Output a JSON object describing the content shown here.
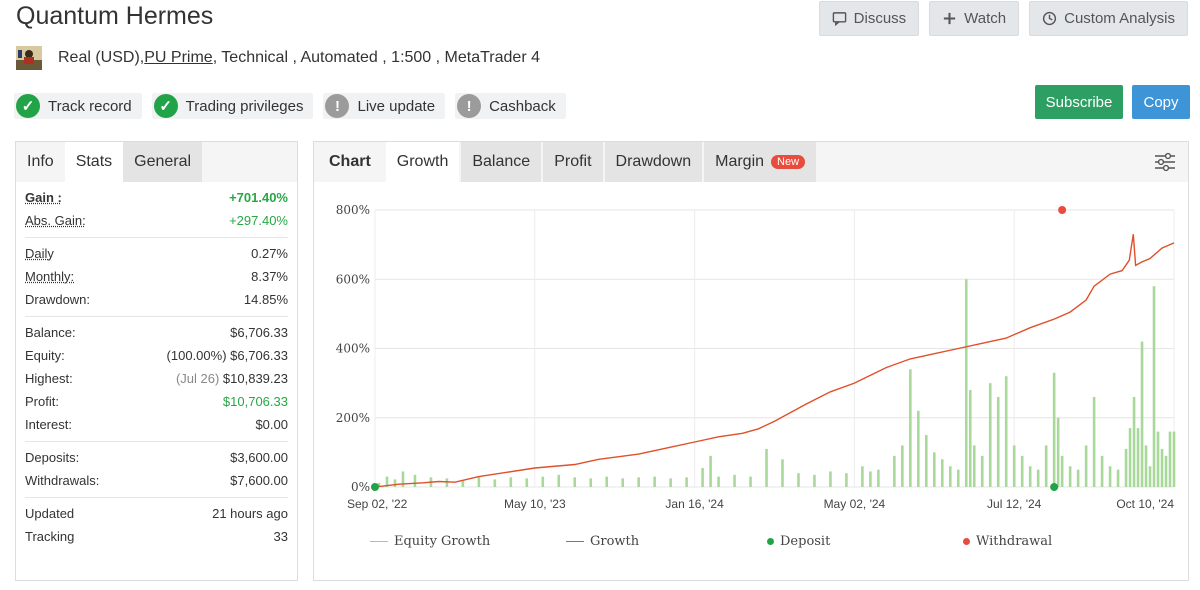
{
  "header": {
    "title": "Quantum Hermes",
    "discuss_label": "Discuss",
    "watch_label": "Watch",
    "custom_analysis_label": "Custom Analysis"
  },
  "subline": {
    "prefix": "Real (USD), ",
    "broker": "PU Prime",
    "suffix": " , Technical , Automated , 1:500 , MetaTrader 4"
  },
  "badges": [
    {
      "label": "Track record",
      "status": "ok"
    },
    {
      "label": "Trading privileges",
      "status": "ok"
    },
    {
      "label": "Live update",
      "status": "warn"
    },
    {
      "label": "Cashback",
      "status": "warn"
    }
  ],
  "actions": {
    "subscribe_label": "Subscribe",
    "copy_label": "Copy"
  },
  "left_tabs": [
    "Info",
    "Stats",
    "General"
  ],
  "stats": {
    "gain_label": "Gain :",
    "gain_value": "+701.40%",
    "abs_gain_label": "Abs. Gain:",
    "abs_gain_value": "+297.40%",
    "daily_label": "Daily",
    "daily_value": "0.27%",
    "monthly_label": "Monthly:",
    "monthly_value": "8.37%",
    "drawdown_label": "Drawdown:",
    "drawdown_value": "14.85%",
    "balance_label": "Balance:",
    "balance_value": "$6,706.33",
    "equity_label": "Equity:",
    "equity_pct": "(100.00%)",
    "equity_value": "$6,706.33",
    "highest_label": "Highest:",
    "highest_date": "(Jul 26)",
    "highest_value": "$10,839.23",
    "profit_label": "Profit:",
    "profit_value": "$10,706.33",
    "interest_label": "Interest:",
    "interest_value": "$0.00",
    "deposits_label": "Deposits:",
    "deposits_value": "$3,600.00",
    "withdrawals_label": "Withdrawals:",
    "withdrawals_value": "$7,600.00",
    "updated_label": "Updated",
    "updated_value": "21 hours ago",
    "tracking_label": "Tracking",
    "tracking_value": "33"
  },
  "right_tabs": {
    "chart": "Chart",
    "growth": "Growth",
    "balance": "Balance",
    "profit": "Profit",
    "drawdown": "Drawdown",
    "margin": "Margin",
    "new_badge": "New"
  },
  "colors": {
    "growth": "#e0502a",
    "bars": "#a8d99b",
    "deposit": "#22a347",
    "withdrawal": "#e74c3c",
    "equity": "#e9b93f",
    "subscribe": "#2e9f63",
    "copy": "#3d94d6"
  },
  "chart_data": {
    "type": "line",
    "ylim": [
      0,
      800
    ],
    "y_ticks": [
      "0%",
      "200%",
      "400%",
      "600%",
      "800%"
    ],
    "x_ticks": [
      "Sep 02, '22",
      "May 10, '23",
      "Jan 16, '24",
      "May 02, '24",
      "Jul 12, '24",
      "Oct 10, '24"
    ],
    "legend": [
      "Equity Growth",
      "Growth",
      "Deposit",
      "Withdrawal"
    ],
    "grid": true,
    "growth": [
      [
        0,
        0
      ],
      [
        0.03,
        8
      ],
      [
        0.06,
        12
      ],
      [
        0.08,
        16
      ],
      [
        0.1,
        14
      ],
      [
        0.13,
        30
      ],
      [
        0.2,
        55
      ],
      [
        0.25,
        65
      ],
      [
        0.28,
        80
      ],
      [
        0.33,
        95
      ],
      [
        0.37,
        115
      ],
      [
        0.4,
        130
      ],
      [
        0.43,
        145
      ],
      [
        0.46,
        155
      ],
      [
        0.48,
        168
      ],
      [
        0.5,
        190
      ],
      [
        0.54,
        240
      ],
      [
        0.57,
        275
      ],
      [
        0.6,
        300
      ],
      [
        0.64,
        345
      ],
      [
        0.67,
        370
      ],
      [
        0.7,
        385
      ],
      [
        0.73,
        400
      ],
      [
        0.76,
        415
      ],
      [
        0.79,
        430
      ],
      [
        0.82,
        460
      ],
      [
        0.85,
        485
      ],
      [
        0.87,
        505
      ],
      [
        0.89,
        540
      ],
      [
        0.9,
        580
      ],
      [
        0.92,
        615
      ],
      [
        0.935,
        625
      ],
      [
        0.944,
        655
      ],
      [
        0.949,
        730
      ],
      [
        0.952,
        640
      ],
      [
        0.96,
        650
      ],
      [
        0.97,
        660
      ],
      [
        0.985,
        690
      ],
      [
        1.0,
        705
      ]
    ],
    "bars": [
      [
        0.005,
        12
      ],
      [
        0.015,
        30
      ],
      [
        0.025,
        22
      ],
      [
        0.035,
        45
      ],
      [
        0.05,
        35
      ],
      [
        0.07,
        28
      ],
      [
        0.09,
        25
      ],
      [
        0.11,
        20
      ],
      [
        0.13,
        30
      ],
      [
        0.15,
        22
      ],
      [
        0.17,
        28
      ],
      [
        0.19,
        25
      ],
      [
        0.21,
        30
      ],
      [
        0.23,
        35
      ],
      [
        0.25,
        28
      ],
      [
        0.27,
        25
      ],
      [
        0.29,
        30
      ],
      [
        0.31,
        25
      ],
      [
        0.33,
        28
      ],
      [
        0.35,
        30
      ],
      [
        0.37,
        25
      ],
      [
        0.39,
        28
      ],
      [
        0.41,
        55
      ],
      [
        0.42,
        90
      ],
      [
        0.43,
        30
      ],
      [
        0.45,
        35
      ],
      [
        0.47,
        30
      ],
      [
        0.49,
        110
      ],
      [
        0.51,
        80
      ],
      [
        0.53,
        40
      ],
      [
        0.55,
        35
      ],
      [
        0.57,
        45
      ],
      [
        0.59,
        40
      ],
      [
        0.61,
        60
      ],
      [
        0.62,
        45
      ],
      [
        0.63,
        50
      ],
      [
        0.65,
        90
      ],
      [
        0.66,
        120
      ],
      [
        0.67,
        340
      ],
      [
        0.68,
        220
      ],
      [
        0.69,
        150
      ],
      [
        0.7,
        100
      ],
      [
        0.71,
        80
      ],
      [
        0.72,
        60
      ],
      [
        0.73,
        50
      ],
      [
        0.74,
        600
      ],
      [
        0.745,
        280
      ],
      [
        0.75,
        120
      ],
      [
        0.76,
        90
      ],
      [
        0.77,
        300
      ],
      [
        0.78,
        260
      ],
      [
        0.79,
        320
      ],
      [
        0.8,
        120
      ],
      [
        0.81,
        90
      ],
      [
        0.82,
        60
      ],
      [
        0.83,
        50
      ],
      [
        0.84,
        120
      ],
      [
        0.85,
        330
      ],
      [
        0.855,
        200
      ],
      [
        0.86,
        90
      ],
      [
        0.87,
        60
      ],
      [
        0.88,
        50
      ],
      [
        0.89,
        120
      ],
      [
        0.9,
        260
      ],
      [
        0.91,
        90
      ],
      [
        0.92,
        60
      ],
      [
        0.93,
        50
      ],
      [
        0.94,
        110
      ],
      [
        0.945,
        170
      ],
      [
        0.95,
        260
      ],
      [
        0.955,
        170
      ],
      [
        0.96,
        420
      ],
      [
        0.965,
        120
      ],
      [
        0.97,
        60
      ],
      [
        0.975,
        580
      ],
      [
        0.98,
        160
      ],
      [
        0.985,
        110
      ],
      [
        0.99,
        90
      ],
      [
        0.995,
        160
      ],
      [
        1.0,
        160
      ]
    ],
    "deposits": [
      [
        0.0,
        0
      ],
      [
        0.85,
        0
      ]
    ],
    "withdrawals": [
      [
        0.86,
        800
      ]
    ]
  }
}
